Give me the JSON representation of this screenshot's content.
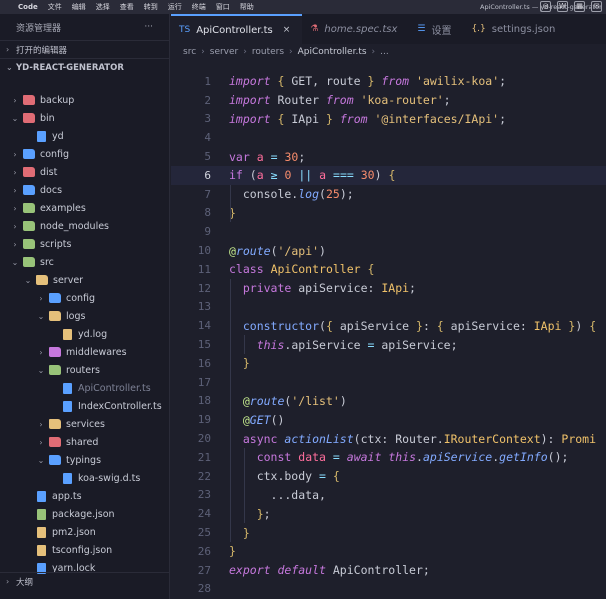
{
  "menubar": {
    "app": "Code",
    "items": [
      "文件",
      "编辑",
      "选择",
      "查看",
      "转到",
      "运行",
      "终端",
      "窗口",
      "帮助"
    ],
    "window_title": "ApiController.ts — yd-react-generator"
  },
  "sidebar": {
    "title": "资源管理器",
    "more": "···",
    "open_editors": "打开的编辑器",
    "project": "YD-REACT-GENERATOR",
    "outline": "大纲",
    "tree": [
      {
        "name": "backup",
        "depth": 0,
        "chev": "›",
        "color": "#e06c75",
        "kind": "folder"
      },
      {
        "name": "bin",
        "depth": 0,
        "chev": "⌄",
        "color": "#e06c75",
        "kind": "folder"
      },
      {
        "name": "yd",
        "depth": 1,
        "chev": "",
        "color": "#5aa0ff",
        "kind": "file"
      },
      {
        "name": "config",
        "depth": 0,
        "chev": "›",
        "color": "#5aa0ff",
        "kind": "folder"
      },
      {
        "name": "dist",
        "depth": 0,
        "chev": "›",
        "color": "#e06c75",
        "kind": "folder"
      },
      {
        "name": "docs",
        "depth": 0,
        "chev": "›",
        "color": "#5aa0ff",
        "kind": "folder"
      },
      {
        "name": "examples",
        "depth": 0,
        "chev": "›",
        "color": "#98c379",
        "kind": "folder"
      },
      {
        "name": "node_modules",
        "depth": 0,
        "chev": "›",
        "color": "#98c379",
        "kind": "folder"
      },
      {
        "name": "scripts",
        "depth": 0,
        "chev": "›",
        "color": "#98c379",
        "kind": "folder"
      },
      {
        "name": "src",
        "depth": 0,
        "chev": "⌄",
        "color": "#98c379",
        "kind": "folder"
      },
      {
        "name": "server",
        "depth": 1,
        "chev": "⌄",
        "color": "#e5c07b",
        "kind": "folder"
      },
      {
        "name": "config",
        "depth": 2,
        "chev": "›",
        "color": "#5aa0ff",
        "kind": "folder"
      },
      {
        "name": "logs",
        "depth": 2,
        "chev": "⌄",
        "color": "#e5c07b",
        "kind": "folder"
      },
      {
        "name": "yd.log",
        "depth": 3,
        "chev": "",
        "color": "#e5c07b",
        "kind": "file"
      },
      {
        "name": "middlewares",
        "depth": 2,
        "chev": "›",
        "color": "#c678dd",
        "kind": "folder"
      },
      {
        "name": "routers",
        "depth": 2,
        "chev": "⌄",
        "color": "#98c379",
        "kind": "folder"
      },
      {
        "name": "ApiController.ts",
        "depth": 3,
        "chev": "",
        "color": "#5aa0ff",
        "kind": "file",
        "dim": true
      },
      {
        "name": "IndexController.ts",
        "depth": 3,
        "chev": "",
        "color": "#5aa0ff",
        "kind": "file"
      },
      {
        "name": "services",
        "depth": 2,
        "chev": "›",
        "color": "#e5c07b",
        "kind": "folder"
      },
      {
        "name": "shared",
        "depth": 2,
        "chev": "›",
        "color": "#e06c75",
        "kind": "folder"
      },
      {
        "name": "typings",
        "depth": 2,
        "chev": "⌄",
        "color": "#5aa0ff",
        "kind": "folder"
      },
      {
        "name": "koa-swig.d.ts",
        "depth": 3,
        "chev": "",
        "color": "#5aa0ff",
        "kind": "file"
      },
      {
        "name": "app.ts",
        "depth": 1,
        "chev": "",
        "color": "#5aa0ff",
        "kind": "file"
      },
      {
        "name": "package.json",
        "depth": 1,
        "chev": "",
        "color": "#98c379",
        "kind": "file"
      },
      {
        "name": "pm2.json",
        "depth": 1,
        "chev": "",
        "color": "#e5c07b",
        "kind": "file"
      },
      {
        "name": "tsconfig.json",
        "depth": 1,
        "chev": "",
        "color": "#e5c07b",
        "kind": "file"
      },
      {
        "name": "yarn.lock",
        "depth": 1,
        "chev": "",
        "color": "#5aa0ff",
        "kind": "file"
      }
    ]
  },
  "tabs": [
    {
      "icon": "TS",
      "label": "ApiController.ts",
      "active": true,
      "close": "×",
      "color": "#5aa0ff"
    },
    {
      "icon": "⚗",
      "label": "home.spec.tsx",
      "active": false,
      "italic": true,
      "color": "#e06c75"
    },
    {
      "icon": "☰",
      "label": "设置",
      "active": false,
      "color": "#5aa0ff"
    },
    {
      "icon": "{.}",
      "label": "settings.json",
      "active": false,
      "color": "#e5c07b"
    }
  ],
  "breadcrumb": [
    "src",
    "server",
    "routers",
    "ApiController.ts",
    "..."
  ],
  "code_lines": [
    {
      "n": "1",
      "html": "<span class='ikw'>import</span> <span class='punc'>{</span> GET, route <span class='punc'>}</span> <span class='ikw'>from</span> <span class='str'>'awilix-koa'</span>;"
    },
    {
      "n": "2",
      "html": "<span class='ikw'>import</span> Router <span class='ikw'>from</span> <span class='str'>'koa-router'</span>;"
    },
    {
      "n": "3",
      "html": "<span class='ikw'>import</span> <span class='punc'>{</span> IApi <span class='punc'>}</span> <span class='ikw'>from</span> <span class='str'>'@interfaces/IApi'</span>;"
    },
    {
      "n": "4",
      "html": ""
    },
    {
      "n": "5",
      "html": "<span class='kw'>var</span> <span class='var'>a</span> <span class='op'>=</span> <span class='num'>30</span>;"
    },
    {
      "n": "6",
      "html": "<span class='kw'>if</span> (<span class='var'>a</span> <span class='op'>≥</span> <span class='num'>0</span> <span class='op'>||</span> <span class='var'>a</span> <span class='op'>===</span> <span class='num'>30</span>) <span class='punc'>{</span>",
      "current": true
    },
    {
      "n": "7",
      "html": "  console.<span class='ifn'>log</span>(<span class='num'>25</span>);"
    },
    {
      "n": "8",
      "html": "<span class='punc'>}</span>"
    },
    {
      "n": "9",
      "html": ""
    },
    {
      "n": "10",
      "html": "<span class='dec'>@</span><span class='ifn'>route</span>(<span class='str'>'/api'</span>)"
    },
    {
      "n": "11",
      "html": "<span class='kw'>class</span> <span class='cls'>ApiController</span> <span class='punc'>{</span>"
    },
    {
      "n": "12",
      "html": "  <span class='kw'>private</span> apiService: <span class='typ'>IApi</span>;"
    },
    {
      "n": "13",
      "html": ""
    },
    {
      "n": "14",
      "html": "  <span class='fn'>constructor</span>(<span class='punc'>{</span> apiService <span class='punc'>}</span>: <span class='punc'>{</span> apiService: <span class='typ'>IApi</span> <span class='punc'>}</span>) <span class='punc'>{</span>"
    },
    {
      "n": "15",
      "html": "    <span class='this'>this</span>.apiService <span class='op'>=</span> apiService;"
    },
    {
      "n": "16",
      "html": "  <span class='punc'>}</span>"
    },
    {
      "n": "17",
      "html": ""
    },
    {
      "n": "18",
      "html": "  <span class='dec'>@</span><span class='ifn'>route</span>(<span class='str'>'/list'</span>)"
    },
    {
      "n": "19",
      "html": "  <span class='dec'>@</span><span class='ifn'>GET</span>()"
    },
    {
      "n": "20",
      "html": "  <span class='kw'>async</span> <span class='ifn'>actionList</span>(ctx: Router.<span class='typ'>IRouterContext</span>): <span class='typ'>Promi</span>"
    },
    {
      "n": "21",
      "html": "    <span class='kw'>const</span> <span class='var'>data</span> <span class='op'>=</span> <span class='ikw'>await</span> <span class='this'>this</span>.<span class='ifn'>apiService</span>.<span class='ifn'>getInfo</span>();"
    },
    {
      "n": "22",
      "html": "    ctx.body <span class='op'>=</span> <span class='punc'>{</span>"
    },
    {
      "n": "23",
      "html": "      ...data,"
    },
    {
      "n": "24",
      "html": "    <span class='punc'>}</span>;"
    },
    {
      "n": "25",
      "html": "  <span class='punc'>}</span>"
    },
    {
      "n": "26",
      "html": "<span class='punc'>}</span>"
    },
    {
      "n": "27",
      "html": "<span class='ikw'>export</span> <span class='ikw'>default</span> ApiController;"
    },
    {
      "n": "28",
      "html": ""
    }
  ],
  "colors": {
    "accent": "#5aa0ff",
    "bg": "#1e1f2b",
    "sidebar": "#1a1b26"
  }
}
